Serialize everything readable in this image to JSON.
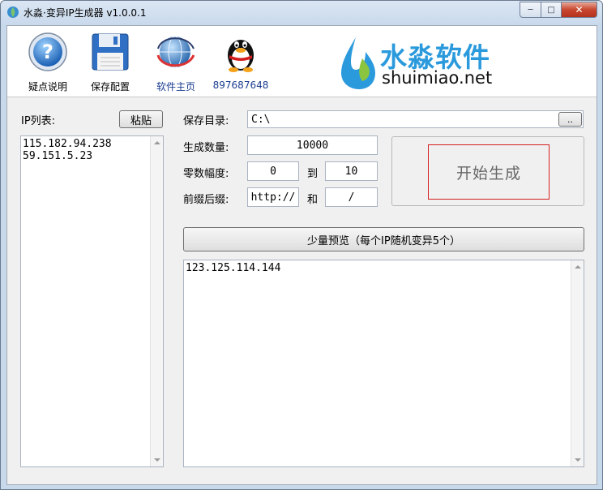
{
  "window": {
    "title": "水淼·变异IP生成器 v1.0.0.1"
  },
  "toolbar": {
    "faq_label": "疑点说明",
    "save_config_label": "保存配置",
    "homepage_label": "软件主页",
    "qq_label": "897687648"
  },
  "logo": {
    "cn": "水淼软件",
    "en": "shuimiao.net"
  },
  "ip_list": {
    "label": "IP列表:",
    "paste_label": "粘贴",
    "lines": [
      "115.182.94.238",
      "59.151.5.23"
    ]
  },
  "form": {
    "save_dir_label": "保存目录:",
    "save_dir_value": "C:\\",
    "browse_label": "..",
    "count_label": "生成数量:",
    "count_value": "10000",
    "zero_range_label": "零数幅度:",
    "zero_from": "0",
    "to_label": "到",
    "zero_to": "10",
    "prefix_suffix_label": "前缀后缀:",
    "prefix_value": "http://",
    "and_label": "和",
    "suffix_value": "/"
  },
  "start_button_label": "开始生成",
  "preview": {
    "button_label": "少量预览（每个IP随机变异5个）",
    "lines": [
      "123.125.114.144"
    ]
  },
  "colors": {
    "logo_blue": "#2b9adc",
    "start_border": "#d42020"
  }
}
